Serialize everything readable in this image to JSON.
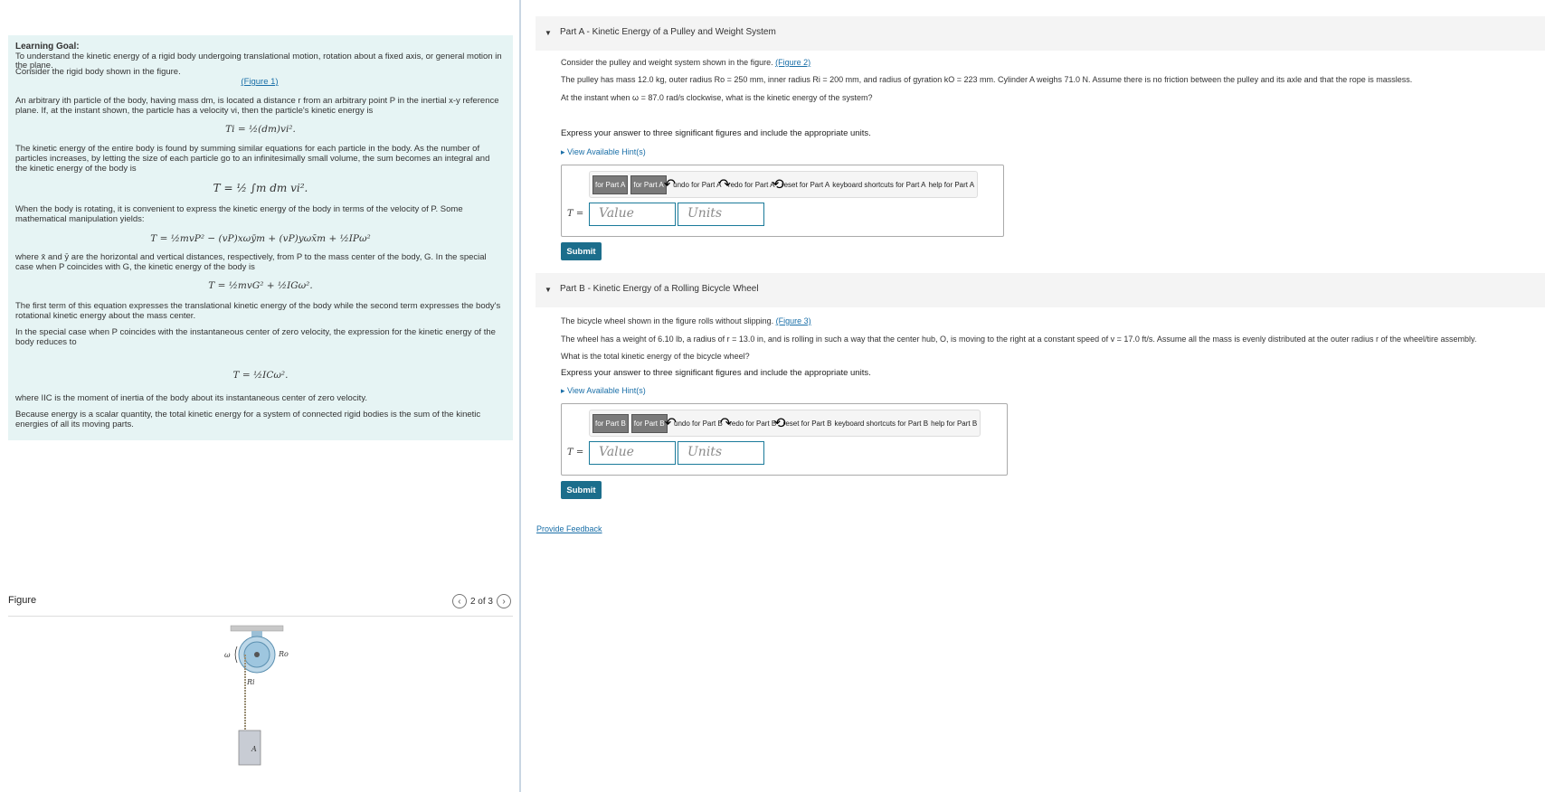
{
  "left": {
    "goal_title": "Learning Goal:",
    "goal_text": "To understand the kinetic energy of a rigid body undergoing translational motion, rotation about a fixed axis, or general motion in the plane.",
    "consider": "Consider the rigid body shown in the figure.",
    "figure_link": "(Figure 1)",
    "para1": "An arbitrary ith particle of the body, having mass dm, is located a distance r from an arbitrary point P in the inertial x-y reference plane. If, at the instant shown, the particle has a velocity vi, then the particle's kinetic energy is",
    "eq1": "Ti = ½(dm)vi².",
    "para2": "The kinetic energy of the entire body is found by summing similar equations for each particle in the body. As the number of particles increases, by letting the size of each particle go to an infinitesimally small volume, the sum becomes an integral and the kinetic energy of the body is",
    "eq2": "T = ½ ∫m dm vi².",
    "para3": "When the body is rotating, it is convenient to express the kinetic energy of the body in terms of the velocity of P. Some mathematical manipulation yields:",
    "eq3": "T = ½mvP² − (vP)xωȳm + (vP)yωx̄m + ½IPω²",
    "para4": "where x̄ and ȳ are the horizontal and vertical distances, respectively, from P to the mass center of the body, G. In the special case when P coincides with G, the kinetic energy of the body is",
    "eq4": "T = ½mvG² + ½IGω².",
    "para5": "The first term of this equation expresses the translational kinetic energy of the body while the second term expresses the body's rotational kinetic energy about the mass center.",
    "para6": "In the special case when P coincides with the instantaneous center of zero velocity, the expression for the kinetic energy of the body reduces to",
    "eq5": "T = ½ICω².",
    "para7": "where IIC is the moment of inertia of the body about its instantaneous center of zero velocity.",
    "para8": "Because energy is a scalar quantity, the total kinetic energy for a system of connected rigid bodies is the sum of the kinetic energies of all its moving parts.",
    "figure_title": "Figure",
    "pager_text": "2 of 3",
    "figure_labels": {
      "omega": "ω",
      "ro": "Ro",
      "ri": "Ri",
      "a": "A"
    }
  },
  "partA": {
    "title": "Part A - Kinetic Energy of a Pulley and Weight System",
    "intro": "Consider the pulley and weight system shown in the figure.",
    "figure_link": "(Figure 2)",
    "given": "The pulley has mass 12.0 kg, outer radius Ro = 250 mm, inner radius Ri = 200 mm, and radius of gyration kO = 223 mm. Cylinder A weighs 71.0 N. Assume there is no friction between the pulley and its axle and that the rope is massless.",
    "question": "At the instant when ω = 87.0 rad/s clockwise, what is the kinetic energy of the system?",
    "instruction": "Express your answer to three significant figures and include the appropriate units.",
    "hint": "View Available Hint(s)",
    "tb_btn1": "for Part A",
    "tb_btn2": "for Part A",
    "tb_undo": "undo for Part A",
    "tb_redo": "redo for Part A",
    "tb_reset": "reset for Part A",
    "tb_keys": "keyboard shortcuts for Part A",
    "tb_help": "help for Part A",
    "answer_label": "T =",
    "value_placeholder": "Value",
    "units_placeholder": "Units",
    "submit": "Submit"
  },
  "partB": {
    "title": "Part B - Kinetic Energy of a Rolling Bicycle Wheel",
    "intro": "The bicycle wheel shown in the figure rolls without slipping.",
    "figure_link": "(Figure 3)",
    "given": "The wheel has a weight of 6.10 lb, a radius of r = 13.0 in, and is rolling in such a way that the center hub, O, is moving to the right at a constant speed of v = 17.0 ft/s. Assume all the mass is evenly distributed at the outer radius r of the wheel/tire assembly.",
    "question": "What is the total kinetic energy of the bicycle wheel?",
    "instruction": "Express your answer to three significant figures and include the appropriate units.",
    "hint": "View Available Hint(s)",
    "tb_btn1": "for Part B",
    "tb_btn2": "for Part B",
    "tb_undo": "undo for Part B",
    "tb_redo": "redo for Part B",
    "tb_reset": "reset for Part B",
    "tb_keys": "keyboard shortcuts for Part B",
    "tb_help": "help for Part B",
    "answer_label": "T =",
    "value_placeholder": "Value",
    "units_placeholder": "Units",
    "submit": "Submit"
  },
  "feedback": "Provide Feedback"
}
